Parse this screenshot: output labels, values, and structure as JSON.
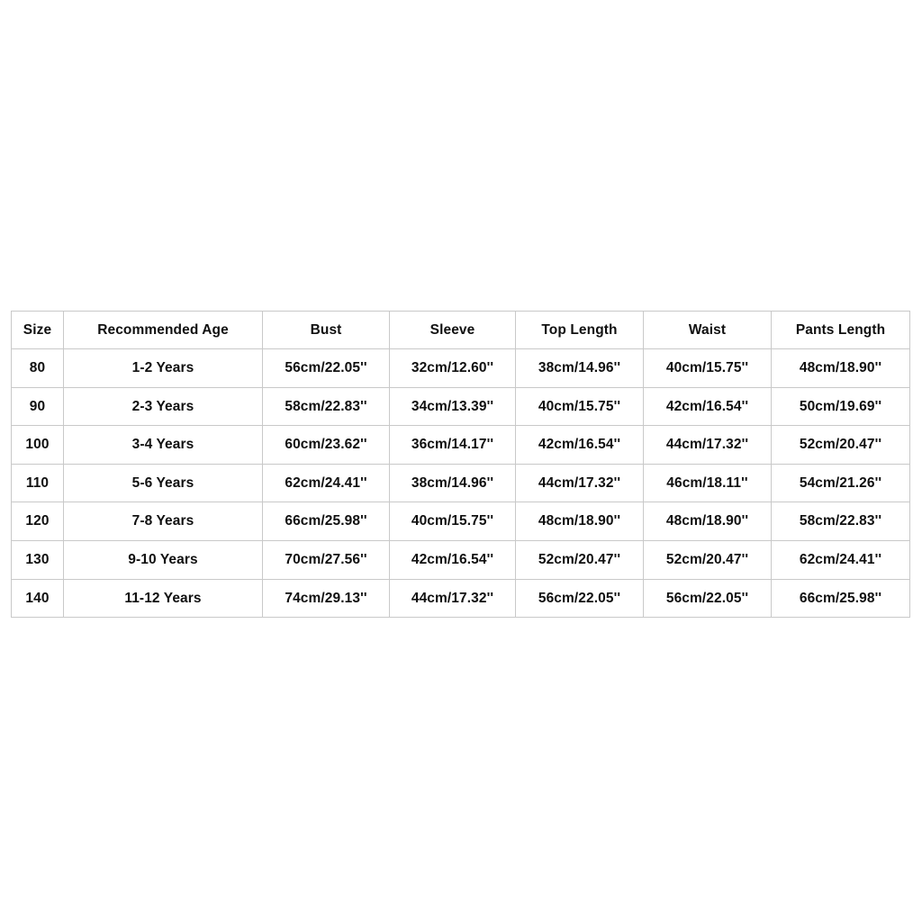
{
  "page": {
    "background_color": "#ffffff",
    "border_color": "#c9c9c9",
    "text_color": "#101010"
  },
  "size_chart": {
    "headers": [
      "Size",
      "Recommended Age",
      "Bust",
      "Sleeve",
      "Top Length",
      "Waist",
      "Pants Length"
    ],
    "rows": [
      {
        "size": "80",
        "age": "1-2 Years",
        "bust": "56cm/22.05''",
        "sleeve": "32cm/12.60''",
        "top_length": "38cm/14.96''",
        "waist": "40cm/15.75''",
        "pants_length": "48cm/18.90''"
      },
      {
        "size": "90",
        "age": "2-3 Years",
        "bust": "58cm/22.83''",
        "sleeve": "34cm/13.39''",
        "top_length": "40cm/15.75''",
        "waist": "42cm/16.54''",
        "pants_length": "50cm/19.69''"
      },
      {
        "size": "100",
        "age": "3-4 Years",
        "bust": "60cm/23.62''",
        "sleeve": "36cm/14.17''",
        "top_length": "42cm/16.54''",
        "waist": "44cm/17.32''",
        "pants_length": "52cm/20.47''"
      },
      {
        "size": "110",
        "age": "5-6 Years",
        "bust": "62cm/24.41''",
        "sleeve": "38cm/14.96''",
        "top_length": "44cm/17.32''",
        "waist": "46cm/18.11''",
        "pants_length": "54cm/21.26''"
      },
      {
        "size": "120",
        "age": "7-8 Years",
        "bust": "66cm/25.98''",
        "sleeve": "40cm/15.75''",
        "top_length": "48cm/18.90''",
        "waist": "48cm/18.90''",
        "pants_length": "58cm/22.83''"
      },
      {
        "size": "130",
        "age": "9-10 Years",
        "bust": "70cm/27.56''",
        "sleeve": "42cm/16.54''",
        "top_length": "52cm/20.47''",
        "waist": "52cm/20.47''",
        "pants_length": "62cm/24.41''"
      },
      {
        "size": "140",
        "age": "11-12 Years",
        "bust": "74cm/29.13''",
        "sleeve": "44cm/17.32''",
        "top_length": "56cm/22.05''",
        "waist": "56cm/22.05''",
        "pants_length": "66cm/25.98''"
      }
    ]
  }
}
